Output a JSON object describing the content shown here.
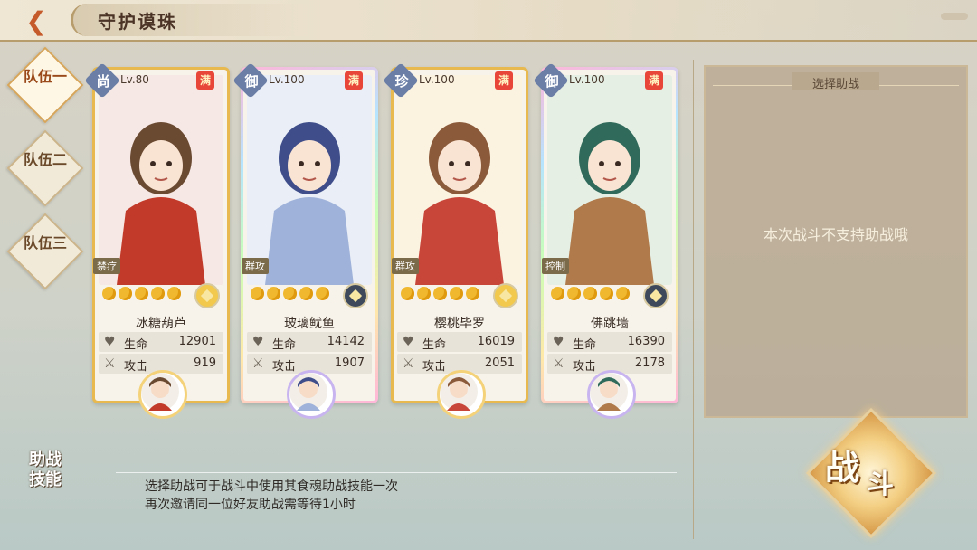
{
  "header": {
    "title": "守护谟珠"
  },
  "tabs": [
    {
      "label": "队伍一",
      "active": true
    },
    {
      "label": "队伍二",
      "active": false
    },
    {
      "label": "队伍三",
      "active": false
    }
  ],
  "cards": [
    {
      "rank": "尚",
      "level": "Lv.80",
      "max": "满",
      "role": "禁疗",
      "name": "冰糖葫芦",
      "stats": {
        "hp_label": "生命",
        "hp": "12901",
        "atk_label": "攻击",
        "atk": "919"
      },
      "stars": 5,
      "element": "gold",
      "portrait_colors": [
        "#f6e8e4",
        "#c23b2a",
        "#6b4a32"
      ]
    },
    {
      "rank": "御",
      "level": "Lv.100",
      "max": "满",
      "role": "群攻",
      "name": "玻璃鱿鱼",
      "stats": {
        "hp_label": "生命",
        "hp": "14142",
        "atk_label": "攻击",
        "atk": "1907"
      },
      "stars": 5,
      "element": "dark",
      "portrait_colors": [
        "#e9eef7",
        "#9fb2d9",
        "#3f4e8a"
      ]
    },
    {
      "rank": "珍",
      "level": "Lv.100",
      "max": "满",
      "role": "群攻",
      "name": "樱桃毕罗",
      "stats": {
        "hp_label": "生命",
        "hp": "16019",
        "atk_label": "攻击",
        "atk": "2051"
      },
      "stars": 5,
      "element": "gold",
      "portrait_colors": [
        "#fbf2e0",
        "#c8453a",
        "#8b5a3a"
      ]
    },
    {
      "rank": "御",
      "level": "Lv.100",
      "max": "满",
      "role": "控制",
      "name": "佛跳墙",
      "stats": {
        "hp_label": "生命",
        "hp": "16390",
        "atk_label": "攻击",
        "atk": "2178"
      },
      "stars": 5,
      "element": "dark",
      "portrait_colors": [
        "#e6efe4",
        "#b07a4a",
        "#2f6a5a"
      ]
    }
  ],
  "panel": {
    "title": "选择助战",
    "message": "本次战斗不支持助战哦"
  },
  "assist": {
    "label_line1": "助战",
    "label_line2": "技能",
    "desc_line1": "选择助战可于战斗中使用其食魂助战技能一次",
    "desc_line2": "再次邀请同一位好友助战需等待1小时"
  },
  "fight": {
    "label": "战斗"
  },
  "icons": {
    "back": "back-arrow-icon",
    "hp": "heart-icon",
    "atk": "sword-icon"
  }
}
